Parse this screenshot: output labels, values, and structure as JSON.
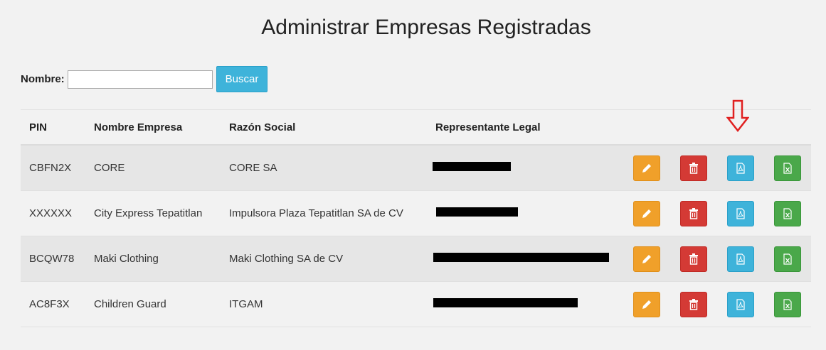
{
  "page": {
    "title": "Administrar Empresas Registradas"
  },
  "search": {
    "label": "Nombre:",
    "value": "",
    "placeholder": "",
    "button_label": "Buscar"
  },
  "table": {
    "headers": [
      "PIN",
      "Nombre Empresa",
      "Razón Social",
      "Representante Legal"
    ],
    "rows": [
      {
        "pin": "CBFN2X",
        "nombre": "CORE",
        "razon": "CORE SA",
        "representante": "[redacted]"
      },
      {
        "pin": "XXXXXX",
        "nombre": "City Express Tepatitlan",
        "razon": "Impulsora Plaza Tepatitlan SA de CV",
        "representante": "[redacted]"
      },
      {
        "pin": "BCQW78",
        "nombre": "Maki Clothing",
        "razon": "Maki Clothing SA de CV",
        "representante": "[redacted]"
      },
      {
        "pin": "AC8F3X",
        "nombre": "Children Guard",
        "razon": "ITGAM",
        "representante": "[redacted]"
      }
    ],
    "actions": [
      {
        "name": "edit",
        "icon": "pencil-icon",
        "color": "#f0a02a"
      },
      {
        "name": "delete",
        "icon": "trash-icon",
        "color": "#d43a35"
      },
      {
        "name": "pdf",
        "icon": "pdf-file-icon",
        "color": "#3eb3da"
      },
      {
        "name": "excel",
        "icon": "excel-file-icon",
        "color": "#4aa84a"
      }
    ]
  },
  "annotation": {
    "icon": "down-arrow-icon",
    "color": "#e02020"
  }
}
